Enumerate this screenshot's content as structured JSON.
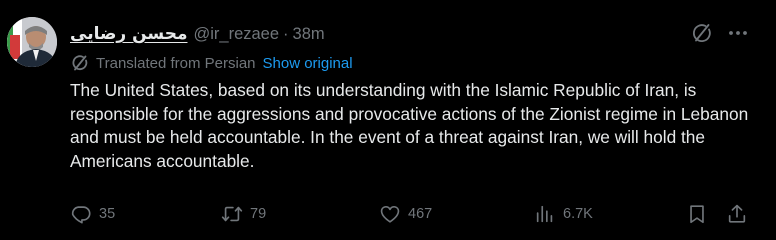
{
  "tweet": {
    "display_name": "محسن رضایی",
    "handle": "@ir_rezaee",
    "separator": "·",
    "time": "38m",
    "translated_label": "Translated from Persian",
    "show_original": "Show original",
    "text": "The United States, based on its understanding with the Islamic Republic of Iran, is responsible for the aggressions and provocative actions of the Zionist regime in Lebanon and must be held accountable. In the event of a threat against Iran, we will hold the Americans accountable."
  },
  "actions": {
    "replies": "35",
    "reposts": "79",
    "likes": "467",
    "views": "6.7K"
  },
  "colors": {
    "background": "#000000",
    "text_primary": "#e7e9ea",
    "text_secondary": "#71767b",
    "link": "#1d9bf0"
  },
  "icons": {
    "reply": "reply-icon",
    "repost": "repost-icon",
    "like": "heart-icon",
    "views": "views-icon",
    "bookmark": "bookmark-icon",
    "share": "share-icon",
    "grok": "grok-icon",
    "more": "more-icon",
    "translate": "translate-icon"
  }
}
